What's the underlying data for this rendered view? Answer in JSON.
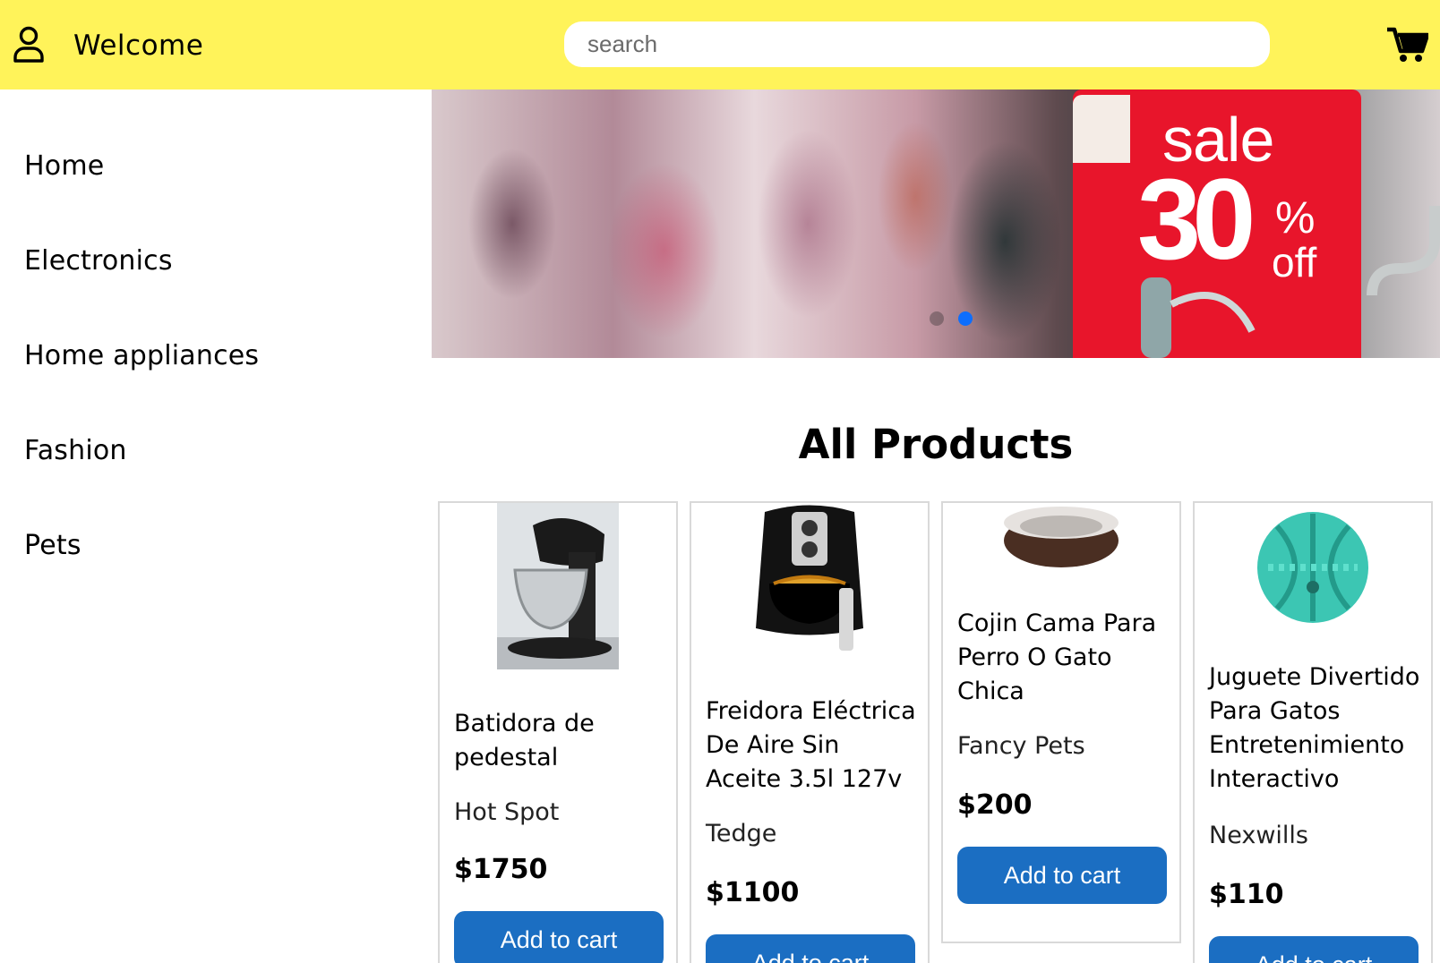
{
  "header": {
    "welcome": "Welcome",
    "search_placeholder": "search",
    "icons": {
      "user": "user-icon",
      "cart": "shopping-cart-icon"
    },
    "background_color": "#fff35a"
  },
  "sidebar": {
    "items": [
      {
        "label": "Home"
      },
      {
        "label": "Electronics"
      },
      {
        "label": "Home appliances"
      },
      {
        "label": "Fashion"
      },
      {
        "label": "Pets"
      }
    ]
  },
  "banner": {
    "sale_word": "sale",
    "sale_number": "30",
    "sale_percent": "%",
    "sale_off": "off",
    "slide_count": 2,
    "active_slide": 2,
    "active_dot_color": "#0d6efd"
  },
  "products": {
    "title": "All Products",
    "button_color": "#1b6ec2",
    "items": [
      {
        "name": "Batidora de pedestal",
        "brand": "Hot Spot",
        "price": "$1750",
        "button": "Add to cart",
        "image": "stand-mixer-image"
      },
      {
        "name": "Freidora Eléctrica De Aire Sin Aceite 3.5l 127v",
        "brand": "Tedge",
        "price": "$1100",
        "button": "Add to cart",
        "image": "air-fryer-image"
      },
      {
        "name": "Cojin Cama Para Perro O Gato Chica",
        "brand": "Fancy Pets",
        "price": "$200",
        "button": "Add to cart",
        "image": "pet-bed-image"
      },
      {
        "name": "Juguete Divertido Para Gatos Entretenimiento Interactivo",
        "brand": "Nexwills",
        "price": "$110",
        "button": "Add to cart",
        "image": "cat-ball-toy-image"
      }
    ]
  }
}
